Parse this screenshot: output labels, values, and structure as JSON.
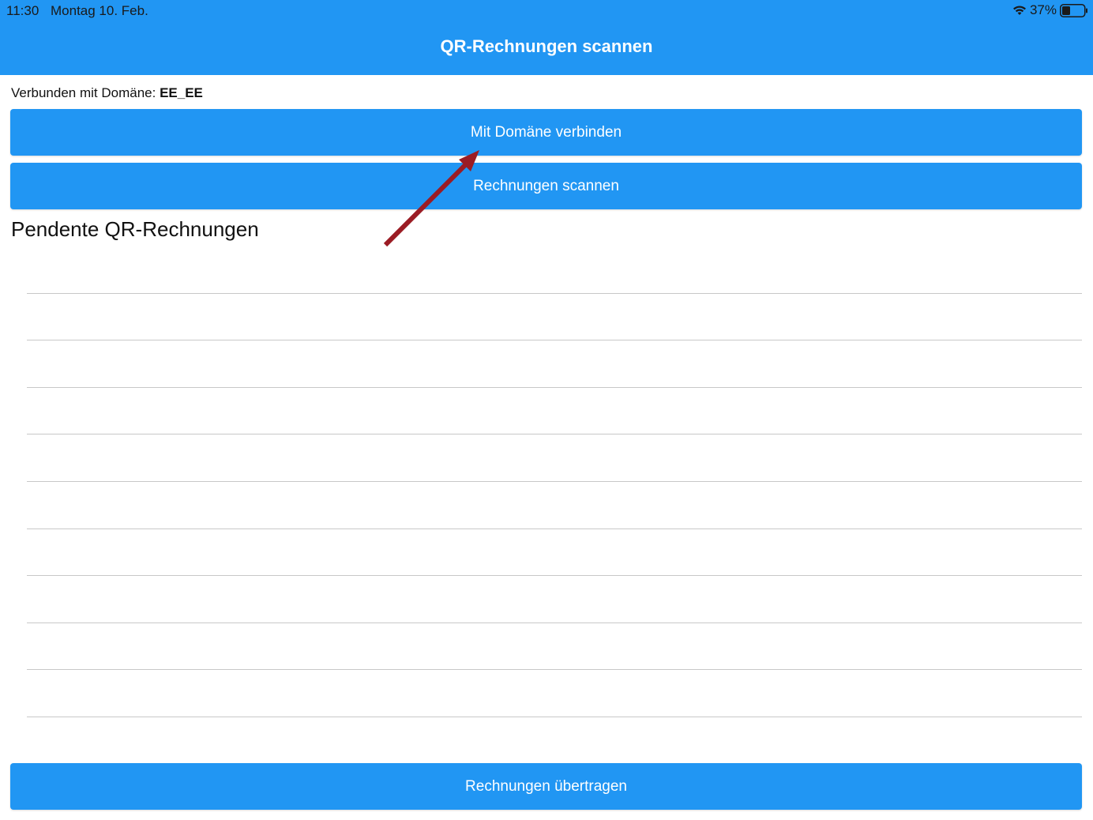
{
  "status_bar": {
    "time": "11:30",
    "date": "Montag 10. Feb.",
    "battery_percent": "37%",
    "battery_level": 0.37,
    "icons": [
      "wifi-icon",
      "battery-icon"
    ]
  },
  "appbar": {
    "title": "QR-Rechnungen scannen"
  },
  "domain": {
    "label": "Verbunden mit Domäne: ",
    "value": "EE_EE"
  },
  "buttons": {
    "connect": "Mit Domäne verbinden",
    "scan": "Rechnungen scannen",
    "transfer": "Rechnungen übertragen"
  },
  "pending": {
    "title": "Pendente QR-Rechnungen",
    "items": [
      "",
      "",
      "",
      "",
      "",
      "",
      "",
      "",
      "",
      ""
    ]
  },
  "annotation": {
    "arrow_color": "#9b1c24",
    "target": "connect-button"
  },
  "colors": {
    "accent": "#2196f3",
    "divider": "#c8c8c8"
  }
}
